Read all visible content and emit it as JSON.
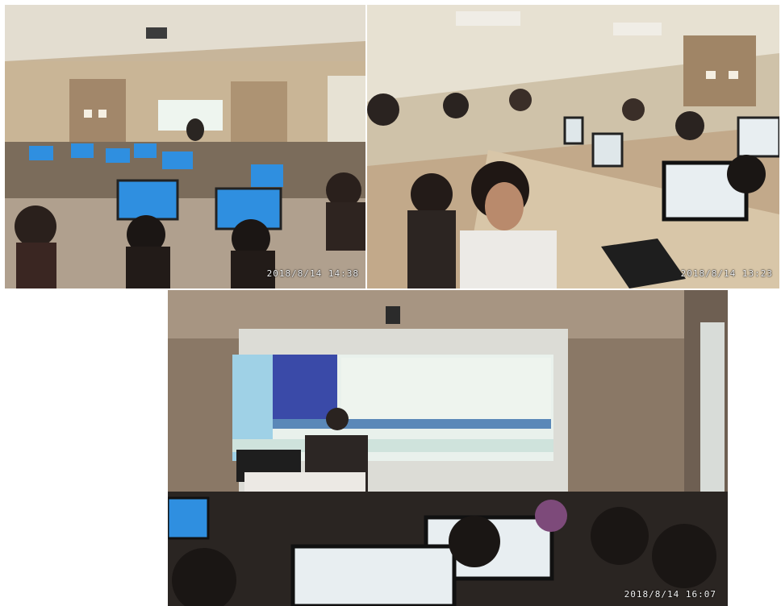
{
  "photos": [
    {
      "label": "lab-overview-photo",
      "timestamp": "2018/8/14 14:38"
    },
    {
      "label": "students-at-workstations-photo",
      "timestamp": "2018/8/14 13:23"
    },
    {
      "label": "instructor-presentation-photo",
      "timestamp": "2018/8/14 16:07"
    }
  ],
  "colors": {
    "wall": "#c9b596",
    "monitor_screen": "#2f8fe0",
    "projection": "#e9f1ec",
    "dark_room": "#2a2522"
  }
}
